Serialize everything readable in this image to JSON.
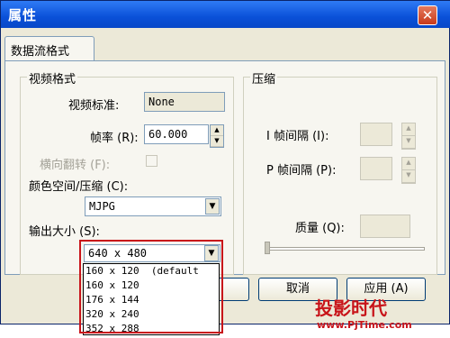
{
  "window": {
    "title": "属性",
    "close_label": "✕"
  },
  "tabs": [
    {
      "label": "数据流格式"
    }
  ],
  "video_format": {
    "group_label": "视频格式",
    "standard_label": "视频标准:",
    "standard_value": "None",
    "frame_rate_label": "帧率 (R):",
    "frame_rate_value": "60.000",
    "flip_label": "横向翻转 (F):",
    "color_space_label": "颜色空间/压缩 (C):",
    "color_space_value": "MJPG",
    "output_size_label": "输出大小 (S):",
    "output_size_value": "640 x 480",
    "output_size_options": [
      "160 x 120  (default",
      "160 x 120",
      "176 x 144",
      "320 x 240",
      "352 x 288"
    ]
  },
  "compression": {
    "group_label": "压缩",
    "i_frame_label": "I 帧间隔 (I):",
    "p_frame_label": "P 帧间隔 (P):",
    "quality_label": "质量 (Q):"
  },
  "buttons": {
    "cancel_label": "取消",
    "apply_label": "应用 (A)"
  },
  "watermark": {
    "text": "投影时代",
    "url": "www.PjTime.com"
  },
  "colors": {
    "title_bar": "#0a50d8",
    "highlight": "#c8141a",
    "dialog_bg": "#ece9d8"
  }
}
